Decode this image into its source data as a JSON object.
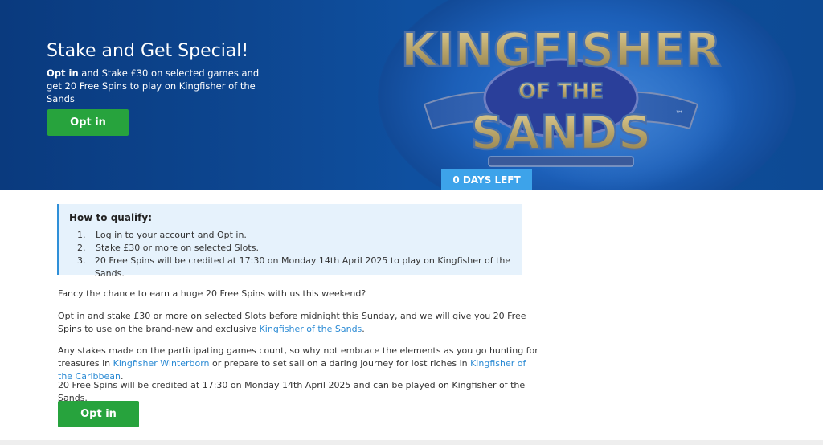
{
  "hero": {
    "title": "Stake and Get Special!",
    "desc_bold": "Opt in",
    "desc_rest": " and Stake £30 on selected games and get 20 Free Spins to play on Kingfisher of the Sands",
    "optin_label": "Opt in",
    "days_left": "0 DAYS LEFT",
    "logo": {
      "line1": "KINGFISHER",
      "line2": "OF THE",
      "line3": "SANDS",
      "tm": "™"
    }
  },
  "qualify": {
    "title": "How to qualify:",
    "steps": [
      {
        "num": "1.",
        "text": "Log in to your account and Opt in."
      },
      {
        "num": "2.",
        "text": "Stake £30 or more on selected Slots."
      },
      {
        "num": "3.",
        "text": "20 Free Spins will be credited at 17:30 on Monday 14th April 2025 to play on Kingfisher of the Sands."
      }
    ]
  },
  "body": {
    "p1": "Fancy the chance to earn a huge 20 Free Spins with us this weekend?",
    "p2_a": "Opt in and stake £30 or more on selected Slots before midnight this Sunday, and we will give you 20 Free Spins to use on the brand-new and exclusive ",
    "p2_link": "Kingfisher of the Sands",
    "p2_b": ".",
    "p3_a": "Any stakes made on the participating games count, so why not embrace the elements as you go hunting for treasures in ",
    "p3_link1": "Kingfisher Winterborn",
    "p3_b": " or prepare to set sail on a daring journey for lost riches in ",
    "p3_link2": "Kingfisher of the Caribbean",
    "p3_c": ".",
    "p4": "20 Free Spins will be credited at 17:30 on Monday 14th April 2025 and can be played on Kingfisher of the Sands.",
    "optin_label": "Opt in"
  },
  "colors": {
    "hero_bg": "#0d4690",
    "button_green": "#27a33d",
    "days_left_bg": "#3da3ea",
    "link": "#2a8ad4",
    "qualify_bg": "#e6f2fc"
  }
}
